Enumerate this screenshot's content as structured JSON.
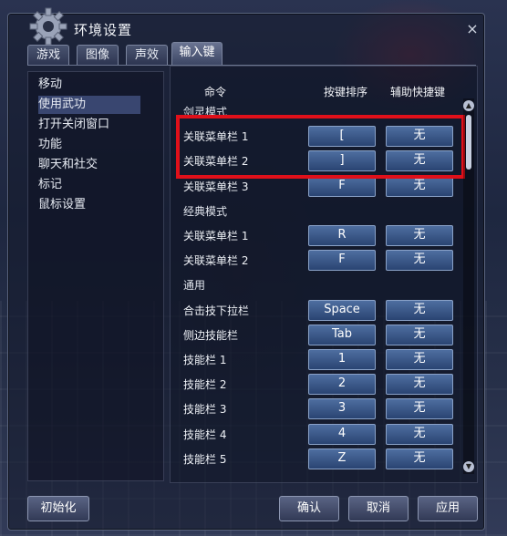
{
  "window": {
    "title": "环境设置",
    "close": "×"
  },
  "tabs": [
    {
      "label": "游戏"
    },
    {
      "label": "图像"
    },
    {
      "label": "声效"
    },
    {
      "label": "输入键"
    }
  ],
  "categories": [
    {
      "label": "移动"
    },
    {
      "label": "使用武功"
    },
    {
      "label": "打开关闭窗口"
    },
    {
      "label": "功能"
    },
    {
      "label": "聊天和社交"
    },
    {
      "label": "标记"
    },
    {
      "label": "鼠标设置"
    }
  ],
  "selected_category": "使用武功",
  "columns": {
    "command": "命令",
    "key": "按键排序",
    "aux": "辅助快捷键"
  },
  "rows": [
    {
      "type": "section",
      "label": "剑灵模式"
    },
    {
      "type": "binding",
      "label": "关联菜单栏 1",
      "key": "[",
      "aux": "无"
    },
    {
      "type": "binding",
      "label": "关联菜单栏 2",
      "key": "]",
      "aux": "无"
    },
    {
      "type": "binding",
      "label": "关联菜单栏 3",
      "key": "F",
      "aux": "无"
    },
    {
      "type": "section",
      "label": "经典模式"
    },
    {
      "type": "binding",
      "label": "关联菜单栏 1",
      "key": "R",
      "aux": "无"
    },
    {
      "type": "binding",
      "label": "关联菜单栏 2",
      "key": "F",
      "aux": "无"
    },
    {
      "type": "section",
      "label": "通用"
    },
    {
      "type": "binding",
      "label": "合击技下拉栏",
      "key": "Space",
      "aux": "无"
    },
    {
      "type": "binding",
      "label": "侧边技能栏",
      "key": "Tab",
      "aux": "无"
    },
    {
      "type": "binding",
      "label": "技能栏 1",
      "key": "1",
      "aux": "无"
    },
    {
      "type": "binding",
      "label": "技能栏 2",
      "key": "2",
      "aux": "无"
    },
    {
      "type": "binding",
      "label": "技能栏 3",
      "key": "3",
      "aux": "无"
    },
    {
      "type": "binding",
      "label": "技能栏 4",
      "key": "4",
      "aux": "无"
    },
    {
      "type": "binding",
      "label": "技能栏 5",
      "key": "Z",
      "aux": "无"
    }
  ],
  "footer": {
    "reset": "初始化",
    "ok": "确认",
    "cancel": "取消",
    "apply": "应用"
  },
  "colors": {
    "highlight": "#e0101a",
    "key_button": "#3a5a8c"
  },
  "icons": {
    "title_icon": "gear-icon",
    "close": "close-icon",
    "scroll_up": "arrow-up-icon",
    "scroll_down": "arrow-down-icon"
  }
}
